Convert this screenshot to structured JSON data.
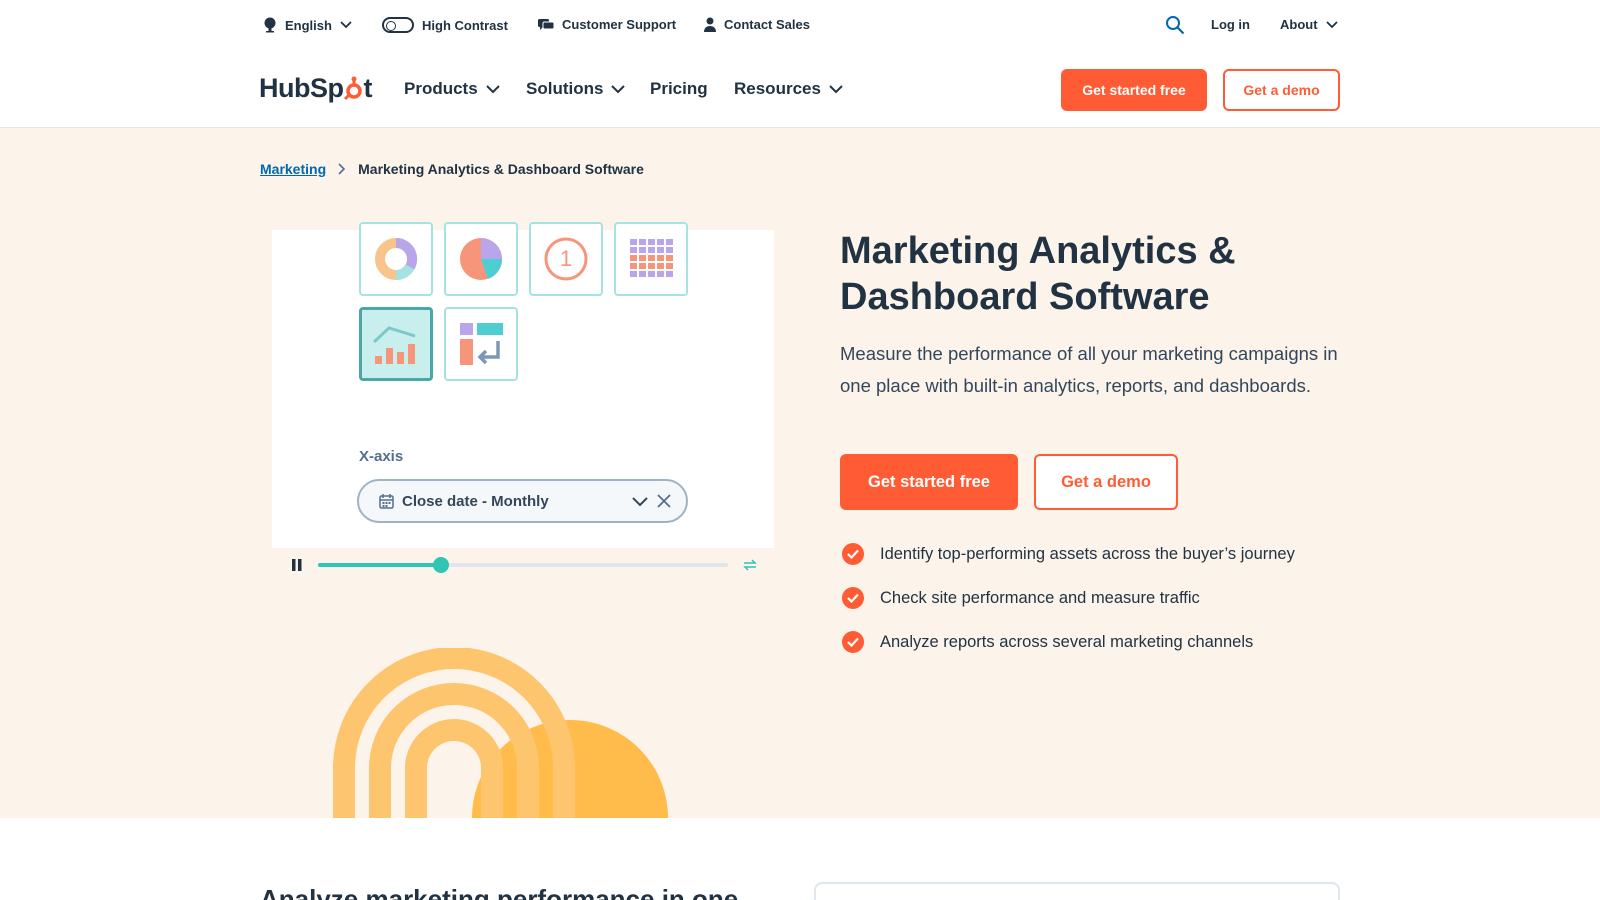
{
  "topbar": {
    "language": "English",
    "high_contrast": "High Contrast",
    "customer_support": "Customer Support",
    "contact_sales": "Contact Sales",
    "login": "Log in",
    "about": "About"
  },
  "nav": {
    "logo_text_a": "HubS",
    "logo_text_b": "p",
    "logo_text_c": "t",
    "items": [
      {
        "label": "Products"
      },
      {
        "label": "Solutions"
      },
      {
        "label": "Pricing"
      },
      {
        "label": "Resources"
      }
    ],
    "cta_primary": "Get started free",
    "cta_secondary": "Get a demo"
  },
  "breadcrumb": {
    "parent": "Marketing",
    "current": "Marketing Analytics & Dashboard Software"
  },
  "demo": {
    "xaxis_label": "X-axis",
    "xaxis_value": "Close date - Monthly",
    "tile_number": "1",
    "progress": 0.3
  },
  "hero": {
    "title": "Marketing Analytics & Dashboard Software",
    "description": "Measure the performance of all your marketing campaigns in one place with built-in analytics, reports, and dashboards.",
    "cta_primary": "Get started free",
    "cta_secondary": "Get a demo",
    "features": [
      "Identify top-performing assets across the buyer’s journey",
      "Check site performance and measure traffic",
      "Analyze reports across several marketing channels"
    ]
  },
  "next_section": {
    "title": "Analyze marketing performance in one"
  },
  "colors": {
    "accent": "#ff5c35",
    "text": "#213343",
    "hero_bg": "#fcf3ea",
    "link": "#0068b1",
    "teal": "#2fc5b2"
  }
}
